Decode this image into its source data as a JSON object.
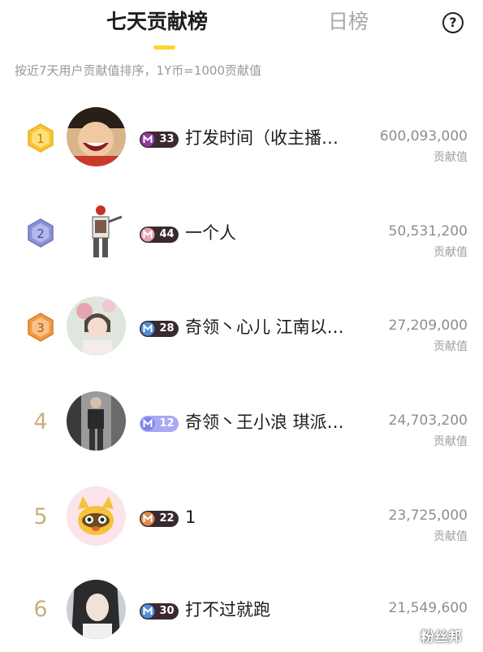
{
  "tabs": {
    "weekly_label": "七天贡献榜",
    "daily_label": "日榜",
    "help_icon": "question-icon",
    "help_glyph": "?"
  },
  "subtitle": "按近7天用户贡献值排序，1Y币=1000贡献值",
  "score_unit": "贡献值",
  "colors": {
    "accent_yellow": "#ffd42e",
    "gold_badge": "#f7c534",
    "silver_badge": "#8a92d6",
    "bronze_badge": "#ef9b45",
    "plain_rank": "#c9b07c",
    "level_pill_dark": "#3a2a2f",
    "level_pill_light": "#a7a9f2"
  },
  "rows": [
    {
      "rank": "1",
      "level": "33",
      "name": "打发时间（收主播…",
      "score": "600,093,000",
      "icon": "level-m-icon"
    },
    {
      "rank": "2",
      "level": "44",
      "name": "一个人",
      "score": "50,531,200",
      "icon": "level-m-icon"
    },
    {
      "rank": "3",
      "level": "28",
      "name": "奇领丶心儿 江南以…",
      "score": "27,209,000",
      "icon": "level-m-icon"
    },
    {
      "rank": "4",
      "level": "12",
      "name": "奇领丶王小浪 琪派…",
      "score": "24,703,200",
      "icon": "level-m-icon"
    },
    {
      "rank": "5",
      "level": "22",
      "name": "1",
      "score": "23,725,000",
      "icon": "level-m-icon"
    },
    {
      "rank": "6",
      "level": "30",
      "name": "打不过就跑",
      "score": "21,549,600",
      "icon": "level-m-icon"
    }
  ],
  "watermark": "粉丝邦"
}
